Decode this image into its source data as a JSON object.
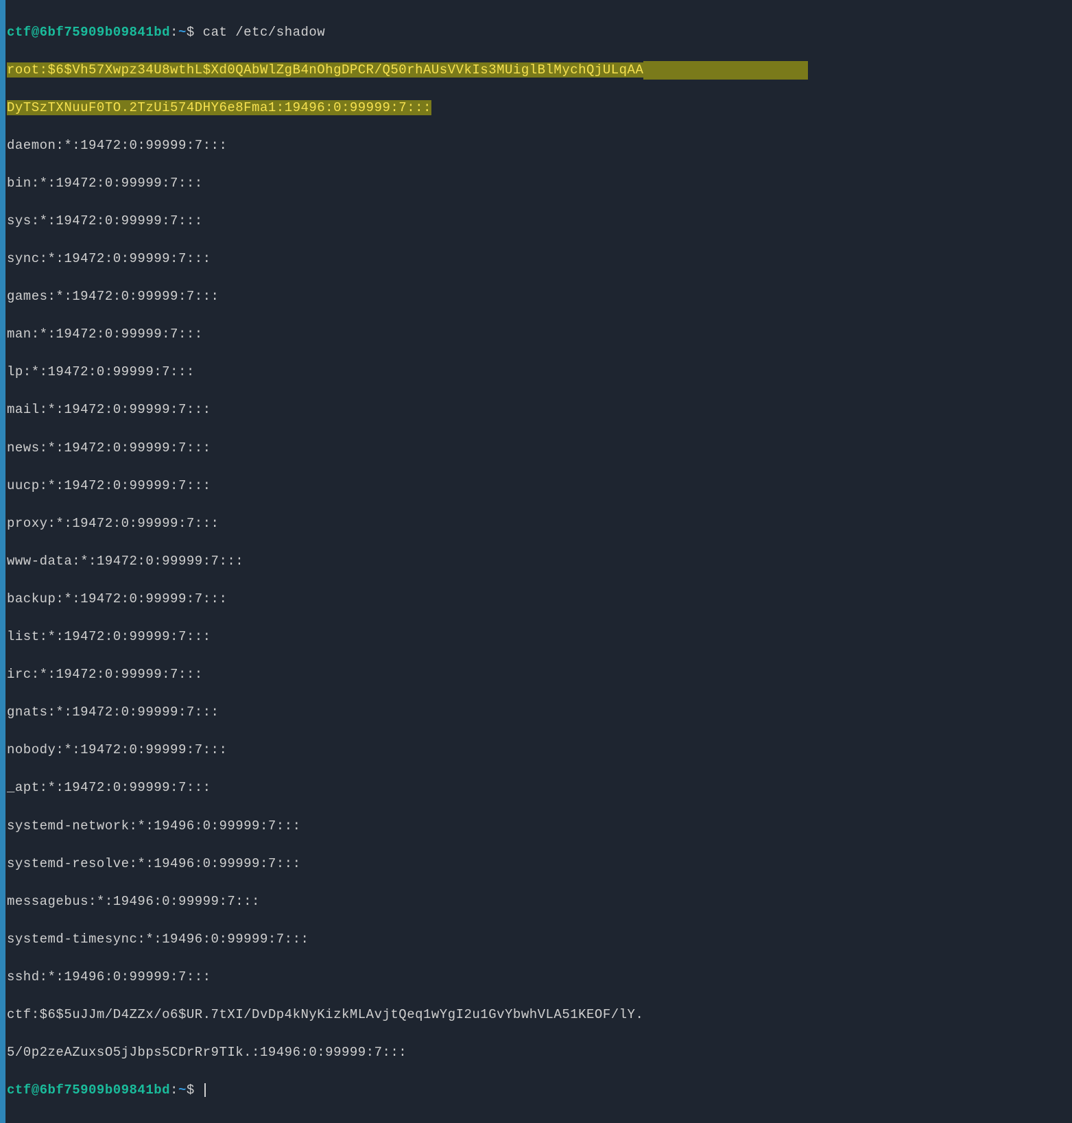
{
  "prompt": {
    "user_host": "ctf@6bf75909b09841bd",
    "separator": ":",
    "path": "~",
    "symbol": "$"
  },
  "command": "cat /etc/shadow",
  "highlighted": {
    "line1": "root:$6$Vh57Xwpz34U8wthL$Xd0QAbWlZgB4nOhgDPCR/Q50rhAUsVVkIs3MUiglBlMychQjULqAA",
    "line2": "DyTSzTXNuuF0TO.2TzUi574DHY6e8Fma1:19496:0:99999:7:::"
  },
  "output_lines": [
    "daemon:*:19472:0:99999:7:::",
    "bin:*:19472:0:99999:7:::",
    "sys:*:19472:0:99999:7:::",
    "sync:*:19472:0:99999:7:::",
    "games:*:19472:0:99999:7:::",
    "man:*:19472:0:99999:7:::",
    "lp:*:19472:0:99999:7:::",
    "mail:*:19472:0:99999:7:::",
    "news:*:19472:0:99999:7:::",
    "uucp:*:19472:0:99999:7:::",
    "proxy:*:19472:0:99999:7:::",
    "www-data:*:19472:0:99999:7:::",
    "backup:*:19472:0:99999:7:::",
    "list:*:19472:0:99999:7:::",
    "irc:*:19472:0:99999:7:::",
    "gnats:*:19472:0:99999:7:::",
    "nobody:*:19472:0:99999:7:::",
    "_apt:*:19472:0:99999:7:::",
    "systemd-network:*:19496:0:99999:7:::",
    "systemd-resolve:*:19496:0:99999:7:::",
    "messagebus:*:19496:0:99999:7:::",
    "systemd-timesync:*:19496:0:99999:7:::",
    "sshd:*:19496:0:99999:7:::",
    "ctf:$6$5uJJm/D4ZZx/o6$UR.7tXI/DvDp4kNyKizkMLAvjtQeq1wYgI2u1GvYbwhVLA51KEOF/lY.",
    "5/0p2zeAZuxsO5jJbps5CDrRr9TIk.:19496:0:99999:7:::"
  ]
}
